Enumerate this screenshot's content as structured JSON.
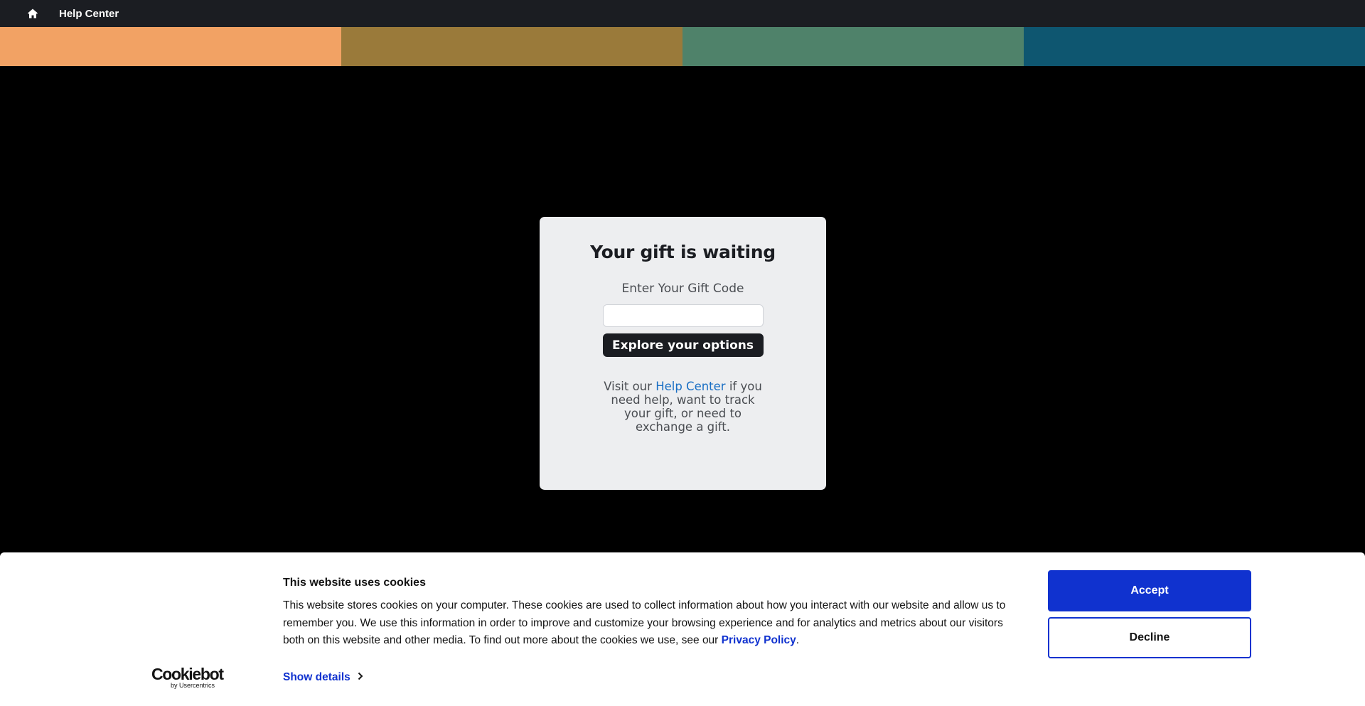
{
  "nav": {
    "home_icon": "home-icon",
    "help_center_label": "Help Center"
  },
  "colorbar": {
    "colors": [
      "#f2a264",
      "#9a7a3a",
      "#4f826a",
      "#0e5670"
    ]
  },
  "card": {
    "title": "Your gift is waiting",
    "code_label": "Enter Your Gift Code",
    "code_value": "",
    "button_label": "Explore your options",
    "help_prefix": "Visit our ",
    "help_link": "Help Center",
    "help_suffix": " if you need help, want to track your gift, or need to exchange a gift."
  },
  "cookie": {
    "logo_main": "Cookiebot",
    "logo_sub": "by Usercentrics",
    "title": "This website uses cookies",
    "text": "This website stores cookies on your computer. These cookies are used to collect information about how you interact with our website and allow us to remember you. We use this information in order to improve and customize your browsing experience and for analytics and metrics about our visitors both on this website and other media. To find out more about the cookies we use, see our ",
    "privacy_link": "Privacy Policy",
    "text_end": ".",
    "show_details": "Show details",
    "accept": "Accept",
    "decline": "Decline",
    "accent_color": "#1032cf"
  }
}
